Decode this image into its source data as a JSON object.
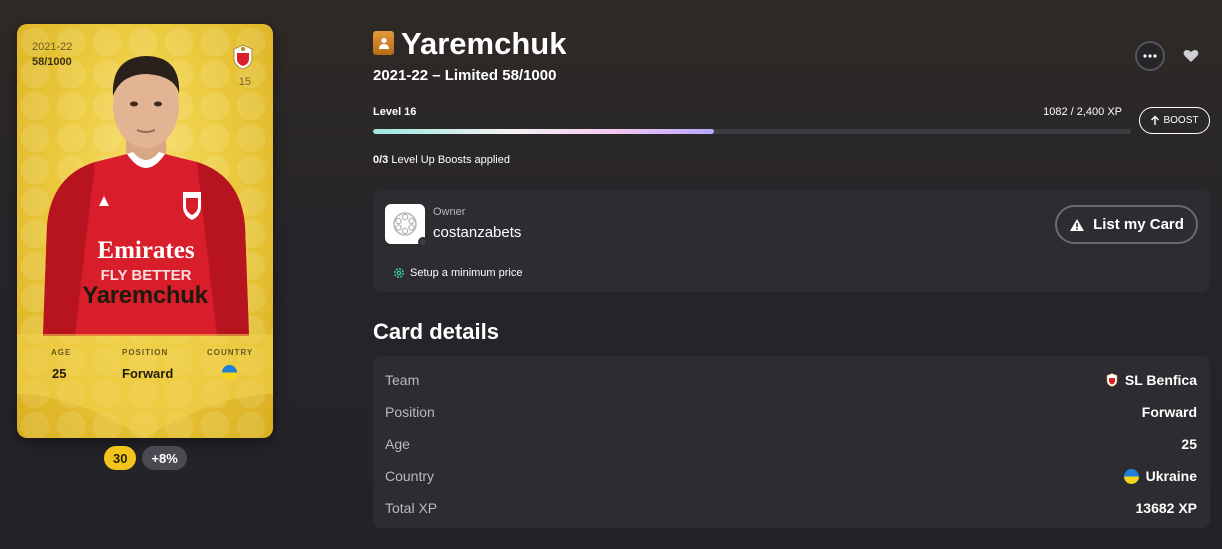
{
  "card": {
    "season": "2021-22",
    "serial": "58/1000",
    "jersey_number": "15",
    "player_name": "Yaremchuk",
    "sponsor_line1": "Emirates",
    "sponsor_line2": "FLY BETTER",
    "attributes": [
      {
        "label": "AGE",
        "value": "25"
      },
      {
        "label": "POSITION",
        "value": "Forward"
      },
      {
        "label": "COUNTRY",
        "value": "ukraine-flag-icon"
      }
    ],
    "score": "30",
    "bonus": "+8%"
  },
  "header": {
    "title": "Yaremchuk",
    "subtitle": "2021-22 – Limited 58/1000"
  },
  "level": {
    "label": "Level 16",
    "xp": "1082 / 2,400 XP",
    "progress": 0.45,
    "boost_label": "BOOST",
    "boosts_count": "0/3",
    "boosts_text": "Level Up Boosts applied"
  },
  "owner": {
    "label": "Owner",
    "name": "costanzabets",
    "min_price": "Setup a minimum price",
    "list_button": "List my Card"
  },
  "details": {
    "title": "Card details",
    "rows": [
      {
        "key": "Team",
        "value": "SL Benfica"
      },
      {
        "key": "Position",
        "value": "Forward"
      },
      {
        "key": "Age",
        "value": "25"
      },
      {
        "key": "Country",
        "value": "Ukraine"
      },
      {
        "key": "Total XP",
        "value": "13682 XP"
      }
    ]
  },
  "colors": {
    "background": "#232227",
    "panel": "#2c2c31",
    "card_gold": "#eccb3f",
    "score_badge": "#f3c51b",
    "benfica_red": "#d81e2a"
  }
}
